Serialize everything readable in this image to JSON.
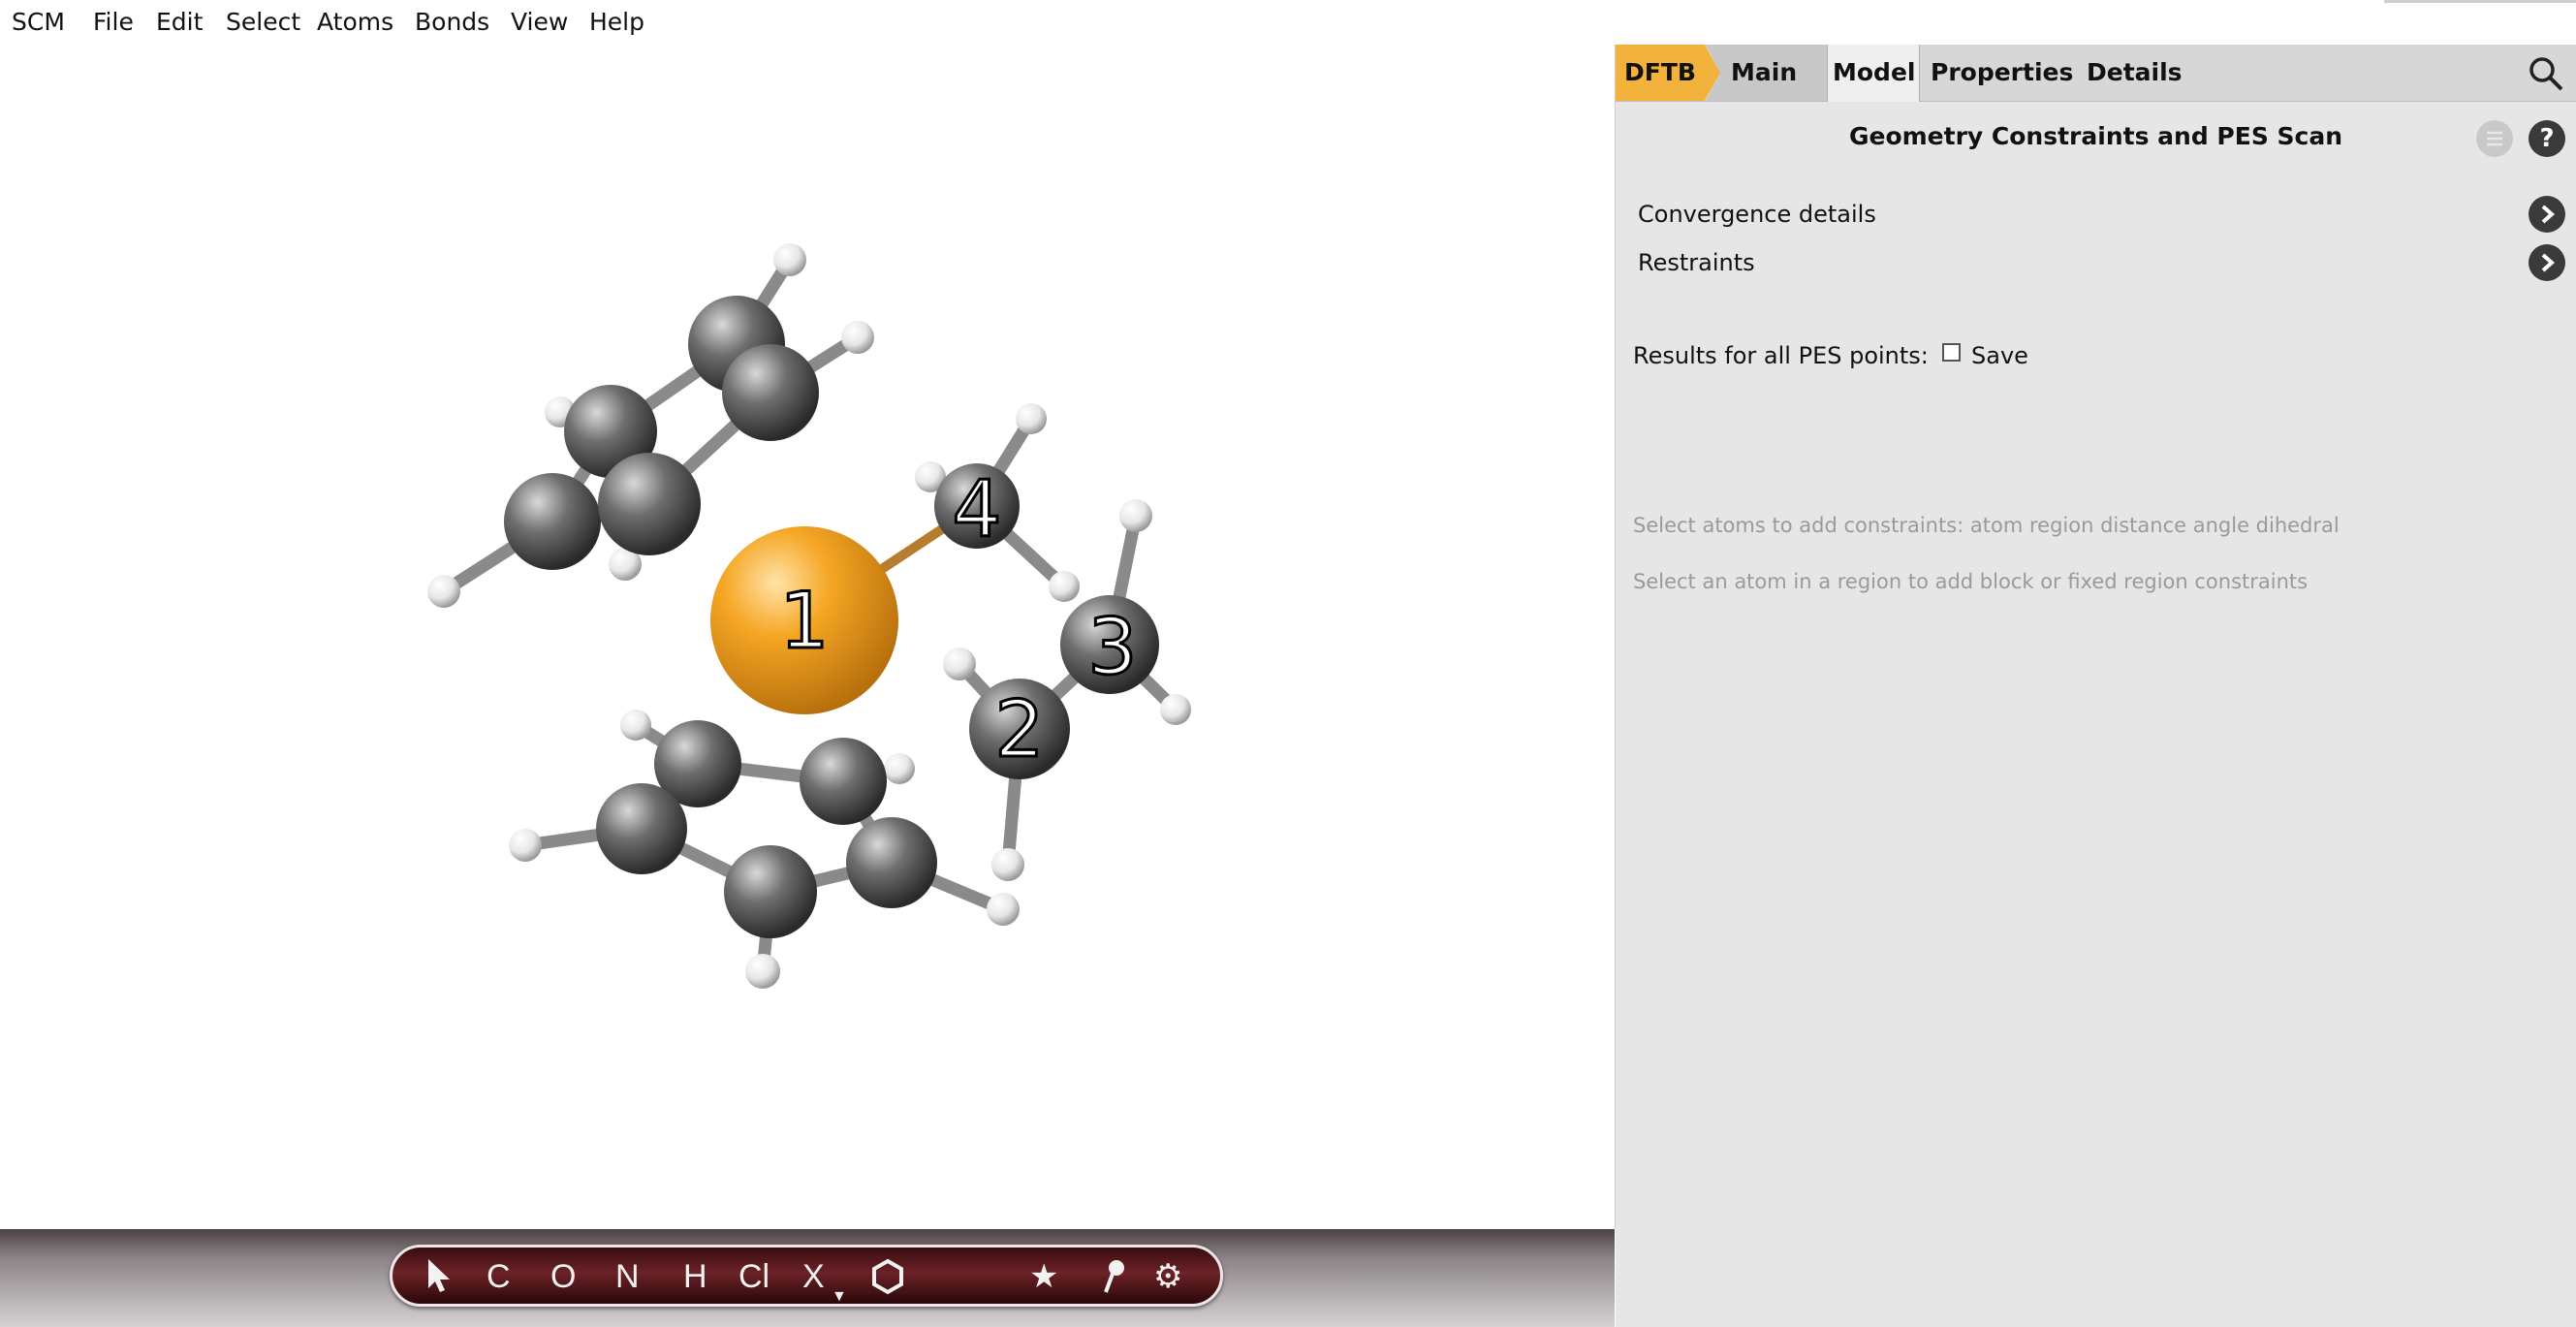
{
  "menu": [
    "SCM",
    "File",
    "Edit",
    "Select",
    "Atoms",
    "Bonds",
    "View",
    "Help"
  ],
  "toolbar": {
    "tools": [
      "C",
      "O",
      "N",
      "H",
      "Cl",
      "X"
    ]
  },
  "atom_labels": [
    "1",
    "2",
    "3",
    "4"
  ],
  "tabs": {
    "dftb": "DFTB",
    "main": "Main",
    "model": "Model",
    "properties": "Properties",
    "details": "Details"
  },
  "panel": {
    "title": "Geometry Constraints and PES Scan",
    "convergence": "Convergence details",
    "restraints": "Restraints",
    "results_label": "Results for all PES points:",
    "save_label": "Save",
    "hint1": "Select atoms to add constraints: atom region distance angle dihedral",
    "hint2": "Select an atom in a region to add block or fixed region constraints"
  },
  "colors": {
    "accent": "#f3b23c",
    "metal_atom": "#f5a623",
    "carbon": "#666666"
  }
}
